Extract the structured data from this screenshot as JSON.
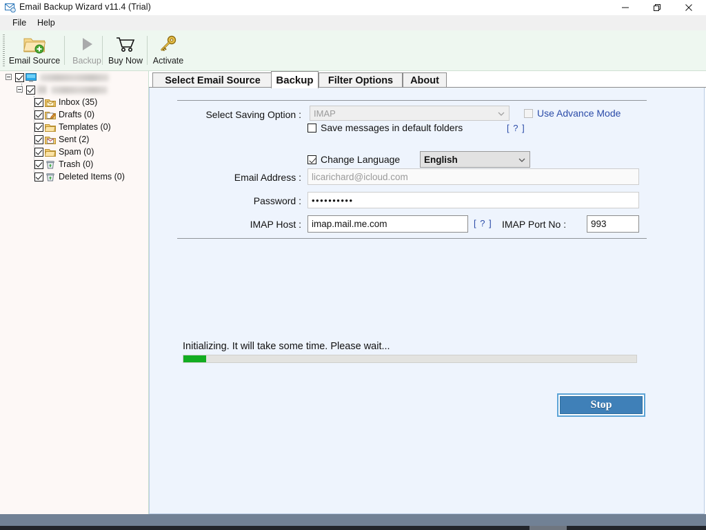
{
  "window": {
    "title": "Email Backup Wizard v11.4 (Trial)",
    "icon": "envelope-app-icon",
    "controls": [
      {
        "name": "minimize-button",
        "glyph": "minimize-icon"
      },
      {
        "name": "maximize-button",
        "glyph": "restore-icon"
      },
      {
        "name": "close-button",
        "glyph": "close-icon"
      }
    ]
  },
  "menubar": {
    "items": [
      {
        "label": "File",
        "name": "menu-file"
      },
      {
        "label": "Help",
        "name": "menu-help"
      }
    ]
  },
  "toolbar": {
    "items": [
      {
        "label": "Email Source",
        "icon": "folder-add-icon",
        "disabled": false
      },
      {
        "label": "Backup",
        "icon": "play-triangle-icon",
        "disabled": true
      },
      {
        "label": "Buy Now",
        "icon": "shopping-cart-icon",
        "disabled": false
      },
      {
        "label": "Activate",
        "icon": "key-icon",
        "disabled": false
      }
    ]
  },
  "sidebar": {
    "root": {
      "label": "",
      "redacted": true,
      "icon": "monitor-icon",
      "checked": true,
      "expanded": true
    },
    "account": {
      "label": "",
      "redacted": true,
      "icon": "account-icon",
      "checked": true,
      "expanded": true
    },
    "folders": [
      {
        "label": "Inbox (35)",
        "icon": "inbox-folder-icon",
        "checked": true
      },
      {
        "label": "Drafts (0)",
        "icon": "drafts-folder-icon",
        "checked": true
      },
      {
        "label": "Templates (0)",
        "icon": "folder-icon",
        "checked": true
      },
      {
        "label": "Sent (2)",
        "icon": "sent-folder-icon",
        "checked": true
      },
      {
        "label": "Spam (0)",
        "icon": "folder-icon",
        "checked": true
      },
      {
        "label": "Trash (0)",
        "icon": "trash-icon",
        "checked": true
      },
      {
        "label": "Deleted Items (0)",
        "icon": "trash-icon",
        "checked": true
      }
    ]
  },
  "tabs": [
    {
      "label": "Select Email Source",
      "active": false
    },
    {
      "label": "Backup",
      "active": true
    },
    {
      "label": "Filter Options",
      "active": false
    },
    {
      "label": "About",
      "active": false
    }
  ],
  "form": {
    "saving_option": {
      "label": "Select Saving Option :",
      "value": "IMAP",
      "disabled": true
    },
    "advance_mode": {
      "label": "Use Advance Mode",
      "checked": false,
      "disabled": true
    },
    "default_folders": {
      "label": "Save messages in default folders",
      "checked": false,
      "help": "[ ? ]"
    },
    "change_language": {
      "label": "Change Language",
      "checked": true,
      "value": "English"
    },
    "email": {
      "label": "Email Address :",
      "value": "licarichard@icloud.com",
      "placeholder": "licarichard@icloud.com",
      "disabled": true
    },
    "password": {
      "label": "Password :",
      "value": "••••••••••",
      "masked_length": 10
    },
    "imap_host": {
      "label": "IMAP Host :",
      "value": "imap.mail.me.com",
      "help": "[ ? ]"
    },
    "imap_port": {
      "label": "IMAP Port No :",
      "value": "993"
    }
  },
  "progress": {
    "status_text": "Initializing. It will take some time. Please wait...",
    "percent": 5
  },
  "actions": {
    "stop_label": "Stop"
  },
  "colors": {
    "accent_blue": "#3f80b8",
    "link_blue": "#2b4ba8",
    "progress_green": "#13ad21",
    "content_bg": "#eef4fd",
    "toolbar_bg": "#eef7f0",
    "sidebar_bg": "#fdf8f6",
    "taskbar": "#718195"
  }
}
